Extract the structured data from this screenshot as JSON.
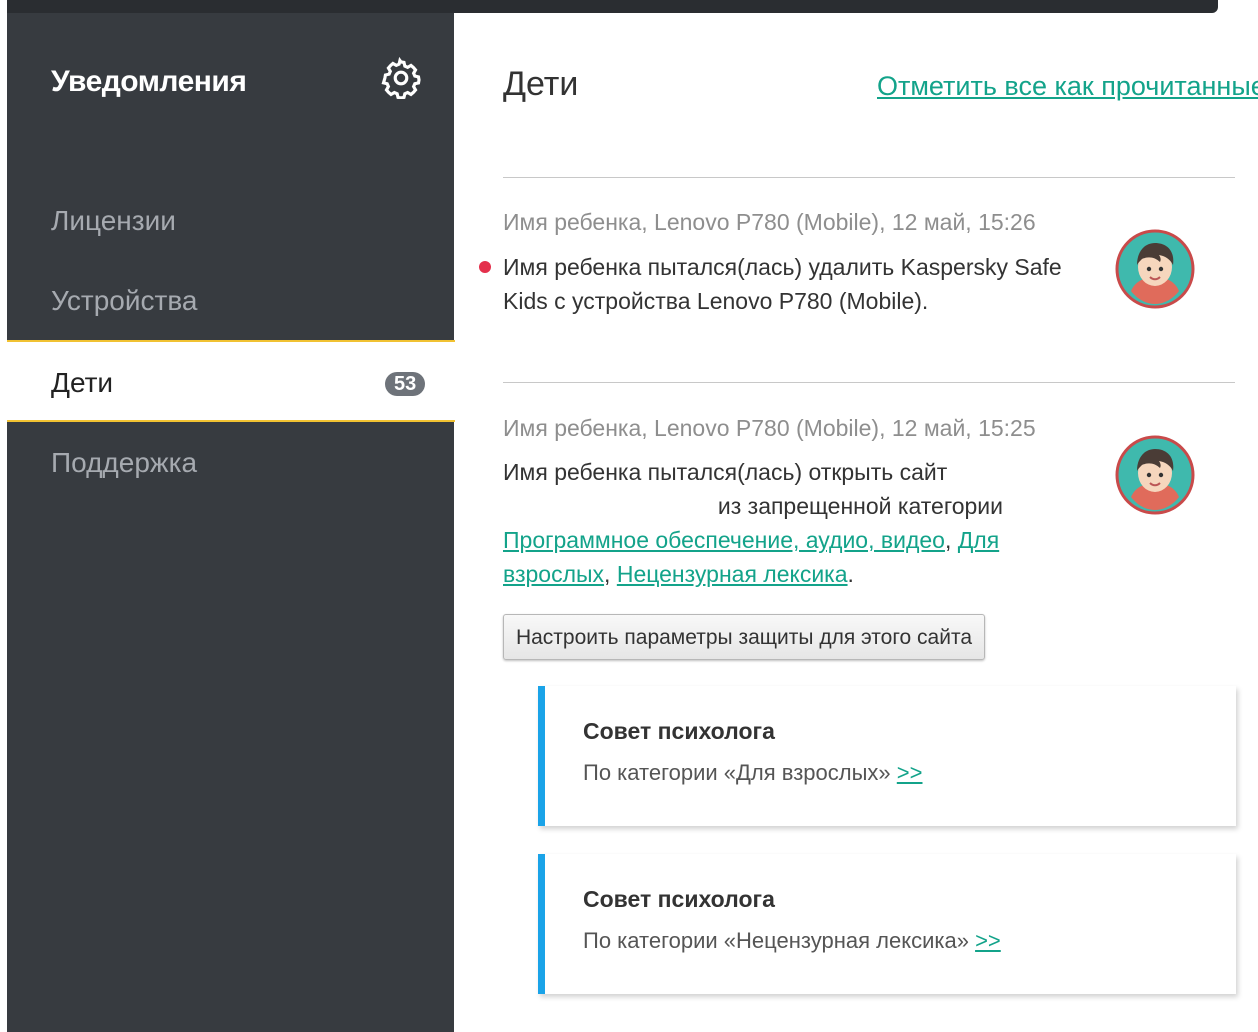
{
  "sidebar": {
    "title": "Уведомления",
    "items": [
      {
        "label": "Лицензии"
      },
      {
        "label": "Устройства"
      },
      {
        "label": "Дети",
        "badge": "53"
      },
      {
        "label": "Поддержка"
      }
    ]
  },
  "main": {
    "title": "Дети",
    "mark_all_label": "Отметить все как прочитанные",
    "notifications": [
      {
        "meta": "Имя ребенка, Lenovo P780 (Mobile), 12 май, 15:26",
        "text": "Имя ребенка пытался(лась) удалить Kaspersky Safe Kids с устройства Lenovo P780 (Mobile).",
        "unread": true
      },
      {
        "meta": "Имя ребенка, Lenovo P780 (Mobile), 12 май, 15:25",
        "text_line1": "Имя ребенка пытался(лась) открыть сайт",
        "text_line2": "из запрещенной категории",
        "categories": [
          "Программное обеспечение, аудио, видео",
          "Для взрослых",
          "Нецензурная лексика"
        ],
        "separator": ", ",
        "end": ".",
        "button_label": "Настроить параметры защиты для этого сайта",
        "tips": [
          {
            "title": "Совет психолога",
            "text": "По категории «Для взрослых»",
            "link": ">>"
          },
          {
            "title": "Совет психолога",
            "text": "По категории «Нецензурная лексика»",
            "link": ">>"
          }
        ]
      }
    ]
  },
  "colors": {
    "sidebar_bg": "#373b40",
    "active_border": "#f1c232",
    "link": "#13a38a",
    "unread_dot": "#e4304c",
    "tip_accent": "#1aa3e8"
  }
}
